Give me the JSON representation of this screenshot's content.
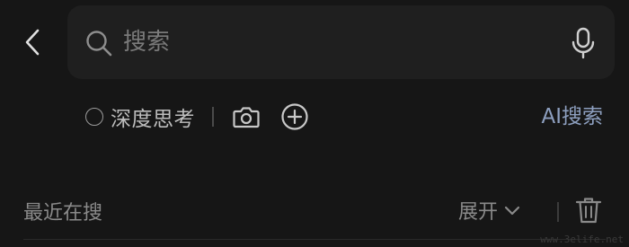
{
  "nav": {
    "back_icon": "chevron-left-icon"
  },
  "search": {
    "placeholder": "搜索",
    "value": "",
    "search_icon": "search-icon",
    "mic_icon": "microphone-icon"
  },
  "toolbar": {
    "deep_think_label": "深度思考",
    "deep_think_checked": false,
    "camera_icon": "camera-icon",
    "add_icon": "plus-circle-icon",
    "ai_search_label": "AI搜索",
    "ai_search_color": "#8d9fbf"
  },
  "recent": {
    "title": "最近在搜",
    "expand_label": "展开",
    "expand_icon": "chevron-down-icon",
    "delete_icon": "trash-icon"
  },
  "watermark": {
    "text": "www.3elife.net"
  },
  "theme": {
    "background": "#161616",
    "search_box": "#1f1f1f"
  }
}
